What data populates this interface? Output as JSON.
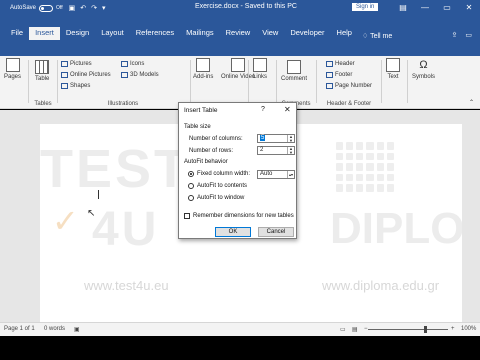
{
  "titlebar": {
    "autosave_label": "AutoSave",
    "autosave_state": "Off",
    "doc_title": "Exercise.docx  -  Saved to this PC",
    "signin_label": "Sign in",
    "ctrl_min": "—",
    "ctrl_max": "▭",
    "ctrl_close": "✕"
  },
  "tabs": [
    {
      "label": "File"
    },
    {
      "label": "Insert"
    },
    {
      "label": "Design"
    },
    {
      "label": "Layout"
    },
    {
      "label": "References"
    },
    {
      "label": "Mailings"
    },
    {
      "label": "Review"
    },
    {
      "label": "View"
    },
    {
      "label": "Developer"
    },
    {
      "label": "Help"
    }
  ],
  "tell_me": "Tell me",
  "ribbon": {
    "pages": "Pages",
    "table": "Table",
    "tables_group": "Tables",
    "pictures": "Pictures",
    "online_pictures": "Online Pictures",
    "shapes": "Shapes",
    "icons": "Icons",
    "models_3d": "3D Models",
    "illustrations_group": "Illustrations",
    "addins": "Add-ins",
    "online_video": "Online Video",
    "links": "Links",
    "comment": "Comment",
    "comments_group": "Comments",
    "header": "Header",
    "footer": "Footer",
    "page_number": "Page Number",
    "header_footer_group": "Header & Footer",
    "text": "Text",
    "symbols": "Symbols"
  },
  "document": {
    "watermark_test": "TEST",
    "watermark_4u": "4U",
    "watermark_diploma": "DIPLOMA",
    "watermark_url1": "www.test4u.eu",
    "watermark_url2": "www.diploma.edu.gr"
  },
  "dialog": {
    "title": "Insert Table",
    "help": "?",
    "close": "✕",
    "table_size_label": "Table size",
    "columns_label": "Number of columns:",
    "columns_value": "5",
    "rows_label": "Number of rows:",
    "rows_value": "2",
    "autofit_label": "AutoFit behavior",
    "fixed_width_label": "Fixed column width:",
    "fixed_width_value": "Auto",
    "autofit_contents_label": "AutoFit to contents",
    "autofit_window_label": "AutoFit to window",
    "remember_label": "Remember dimensions for new tables",
    "ok_label": "OK",
    "cancel_label": "Cancel"
  },
  "status": {
    "page": "Page 1 of 1",
    "words": "0 words",
    "zoom": "100%"
  },
  "accent": "#2b579a"
}
